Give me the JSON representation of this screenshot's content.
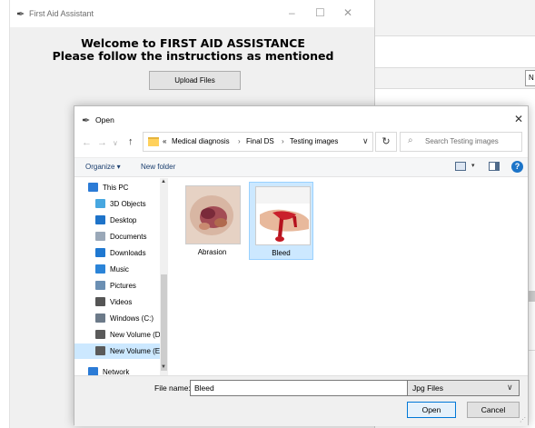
{
  "app": {
    "title": "First Aid Assistant",
    "heading_line1": "Welcome to FIRST AID ASSISTANCE",
    "heading_line2": "Please follow the instructions as mentioned",
    "upload_button": "Upload Files",
    "bg_box_char": "N"
  },
  "dialog": {
    "title": "Open",
    "breadcrumb": [
      "«",
      "Medical diagnosis",
      "Final DS",
      "Testing images"
    ],
    "search_placeholder": "Search Testing images",
    "toolbar": {
      "organize": "Organize ▾",
      "new_folder": "New folder",
      "help": "?"
    },
    "nav_items": [
      {
        "label": "This PC",
        "icon": "computer-icon",
        "color": "#2b7bd6"
      },
      {
        "label": "3D Objects",
        "icon": "cube-icon",
        "color": "#47a7e0"
      },
      {
        "label": "Desktop",
        "icon": "desktop-icon",
        "color": "#1e73c9"
      },
      {
        "label": "Documents",
        "icon": "document-icon",
        "color": "#9aa8b8"
      },
      {
        "label": "Downloads",
        "icon": "download-icon",
        "color": "#1f78d1"
      },
      {
        "label": "Music",
        "icon": "music-icon",
        "color": "#2b84d8"
      },
      {
        "label": "Pictures",
        "icon": "pictures-icon",
        "color": "#6b8fb3"
      },
      {
        "label": "Videos",
        "icon": "video-icon",
        "color": "#555555"
      },
      {
        "label": "Windows (C:)",
        "icon": "drive-icon",
        "color": "#6c7a89"
      },
      {
        "label": "New Volume (D:",
        "icon": "drive-icon",
        "color": "#5a5a5a"
      },
      {
        "label": "New Volume (E:)",
        "icon": "drive-icon",
        "color": "#5a5a5a",
        "selected": true
      },
      {
        "label": "Network",
        "icon": "network-icon",
        "color": "#2b7bd6"
      }
    ],
    "files": [
      {
        "name": "Abrasion",
        "selected": false
      },
      {
        "name": "Bleed",
        "selected": true
      }
    ],
    "file_name_label": "File name:",
    "file_name_value": "Bleed",
    "file_type": "Jpg Files",
    "open_button": "Open",
    "cancel_button": "Cancel"
  }
}
